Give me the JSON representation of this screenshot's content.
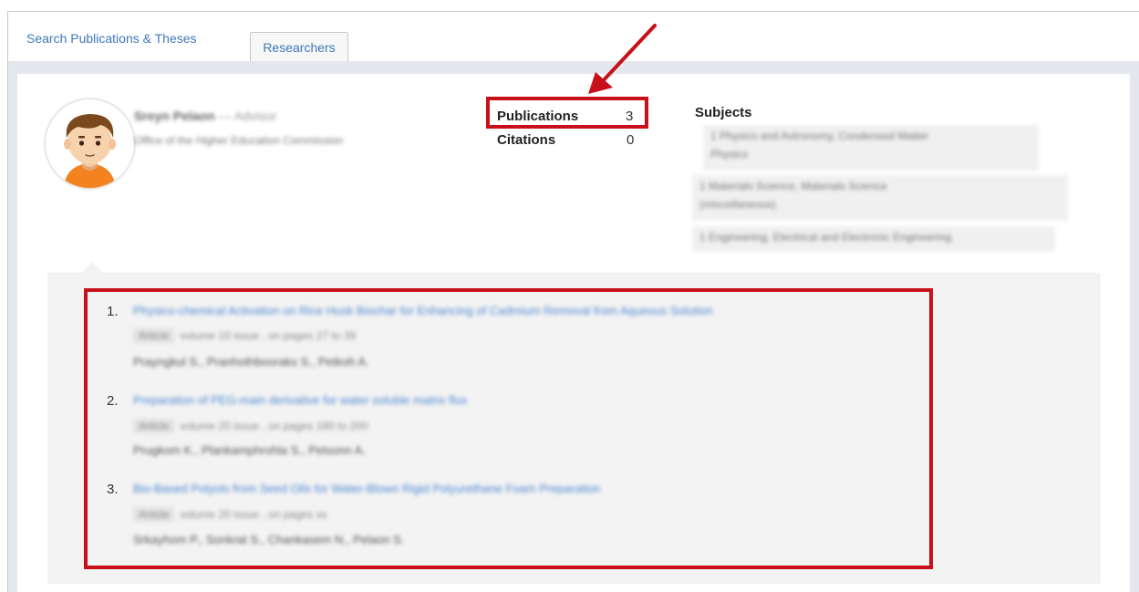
{
  "nav": {
    "search_link": "Search Publications & Theses",
    "researchers_button": "Researchers"
  },
  "profile": {
    "name": "Sreyn Pelaon",
    "role": "— Advisor",
    "organization": "Office of the Higher Education Commission",
    "avatar_icon": "user-avatar-icon"
  },
  "stats": {
    "publications_label": "Publications",
    "publications_value": "3",
    "citations_label": "Citations",
    "citations_value": "0"
  },
  "subjects": {
    "title": "Subjects",
    "items": [
      {
        "line1": "1  Physics and Astronomy, Condensed Matter",
        "line2": "Physics"
      },
      {
        "line1": "1  Materials Science, Materials Science",
        "line2": "(miscellaneous)"
      },
      {
        "line1": "1  Engineering, Electrical and Electronic Engineering",
        "line2": ""
      }
    ]
  },
  "publications": [
    {
      "num": "1.",
      "title": "Physico-chemical Activation on Rice Husk Biochar for Enhancing of Cadmium Removal from Aqueous Solution",
      "tag": "Article",
      "meta": "volume 10 issue , on pages 27 to 39",
      "authors": "Prayngkul S., Pranhothbooraks S., Petkoh A."
    },
    {
      "num": "2.",
      "title": "Preparation of PEG-main derivative for water soluble matrix flux",
      "tag": "Article",
      "meta": "volume 20 issue , on pages 180 to 200",
      "authors": "Prugkom K., Plankamphrohla S., Petsonn A."
    },
    {
      "num": "3.",
      "title": "Bio-Based Polyols from Seed Oils for Water-Blown Rigid Polyurethane Foam Preparation",
      "tag": "Article",
      "meta": "volume 20 issue , on pages xx",
      "authors": "Srkayhom P., Sonkrat S., Chankasem N., Pelaon S."
    }
  ],
  "annotation_color": "#c8101a"
}
